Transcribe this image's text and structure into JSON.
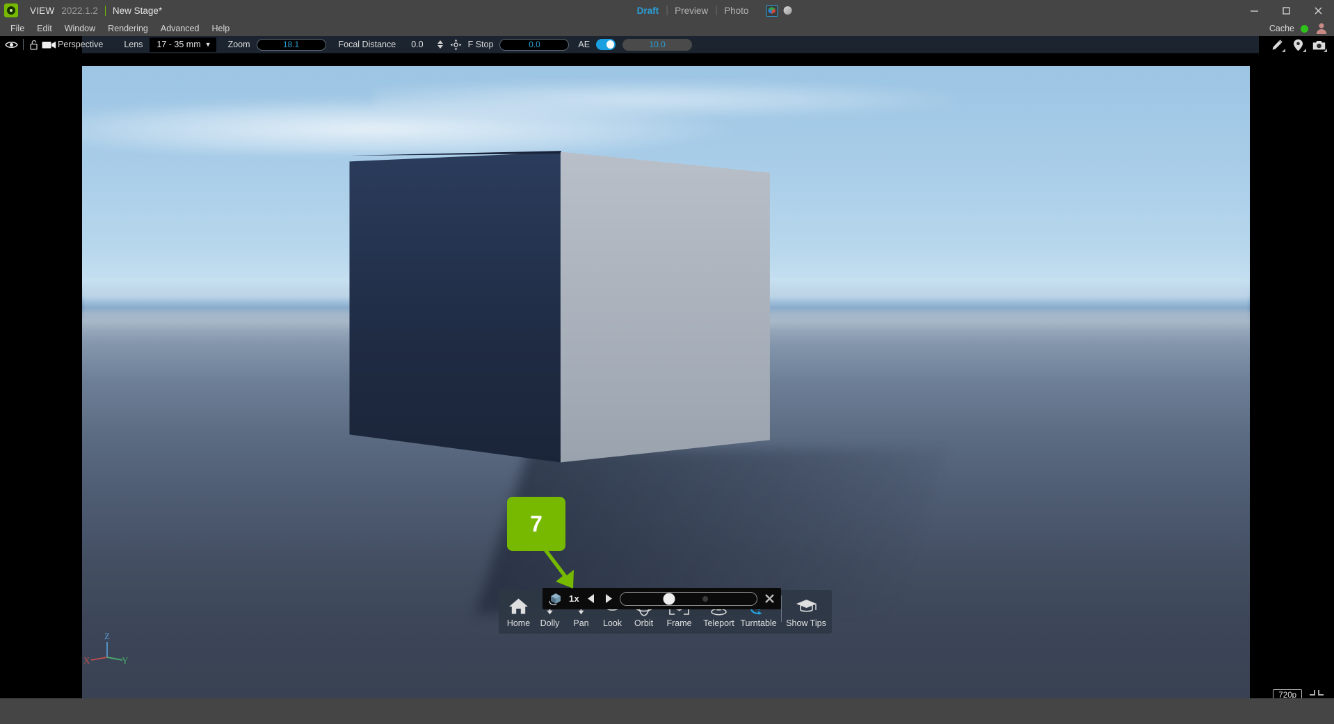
{
  "titlebar": {
    "app_name": "VIEW",
    "version": "2022.1.2",
    "stage_name": "New Stage*",
    "logo_icon": "omniverse-logo-icon",
    "minimize_icon": "minimize-icon",
    "maximize_icon": "maximize-icon",
    "close_icon": "close-icon"
  },
  "render_modes": {
    "tabs": [
      {
        "label": "Draft",
        "active": true
      },
      {
        "label": "Preview",
        "active": false
      },
      {
        "label": "Photo",
        "active": false
      }
    ],
    "rtx_icon": "rtx-cube-icon",
    "material_icon": "material-sphere-icon",
    "accent_color": "#2b9ed6"
  },
  "menubar": {
    "items": [
      "File",
      "Edit",
      "Window",
      "Rendering",
      "Advanced",
      "Help"
    ]
  },
  "cache": {
    "label": "Cache",
    "status_color": "#2ec11c",
    "status_icon": "status-dot-icon",
    "avatar_icon": "user-avatar-icon"
  },
  "camera_toolbar": {
    "visibility_icon": "eye-icon",
    "lock_icon": "lock-open-icon",
    "camera_icon": "camera-icon",
    "camera_name": "Perspective",
    "lens_label": "Lens",
    "lens_value": "17 - 35 mm",
    "lens_caret_icon": "chevron-down-icon",
    "zoom_label": "Zoom",
    "zoom_value": "18.1",
    "focal_distance_label": "Focal Distance",
    "focal_distance_value": "0.0",
    "spinner_icon": "stepper-arrows-icon",
    "focus_target_icon": "focus-crosshair-icon",
    "fstop_label": "F Stop",
    "fstop_value": "0.0",
    "ae_label": "AE",
    "ae_enabled": true,
    "ae_value": "10.0",
    "right_tools": [
      {
        "icon": "pencil-markup-icon"
      },
      {
        "icon": "location-pin-icon"
      },
      {
        "icon": "camera-capture-icon"
      }
    ]
  },
  "viewport": {
    "axis_gizmo": {
      "x_label": "X",
      "x_color": "#c0504d",
      "y_label": "Y",
      "y_color": "#4caf6e",
      "z_label": "Z",
      "z_color": "#5a9ed6"
    },
    "scene": {
      "cube_left_face_color": "#22304c",
      "cube_right_face_color": "#aeb5bf",
      "sky_top_color": "#9cc5e4",
      "ground_color": "#475468"
    }
  },
  "nav_toolbar": {
    "buttons": [
      {
        "label": "Home",
        "icon": "home-icon",
        "active": false
      },
      {
        "label": "Dolly",
        "icon": "dolly-icon",
        "active": false
      },
      {
        "label": "Pan",
        "icon": "pan-icon",
        "active": false
      },
      {
        "label": "Look",
        "icon": "look-icon",
        "active": false
      },
      {
        "label": "Orbit",
        "icon": "orbit-icon",
        "active": false
      },
      {
        "label": "Frame",
        "icon": "frame-icon",
        "active": false
      },
      {
        "label": "Teleport",
        "icon": "teleport-icon",
        "active": false
      },
      {
        "label": "Turntable",
        "icon": "turntable-icon",
        "active": true
      },
      {
        "label": "Show Tips",
        "icon": "graduation-cap-icon",
        "active": false
      }
    ],
    "active_color": "#2b9ed6"
  },
  "turntable_overlay": {
    "cube_icon": "turntable-cube-icon",
    "speed_label": "1x",
    "step_back_icon": "play-backward-icon",
    "step_forward_icon": "play-forward-icon",
    "slider_handle_position_pct": 35,
    "close_icon": "close-icon"
  },
  "callout": {
    "number": "7",
    "color": "#76b900",
    "arrow_icon": "callout-arrow-icon"
  },
  "hud": {
    "resolution": "720p",
    "monitor_icon": "monitor-icon",
    "fullscreen_icon": "collapse-fullscreen-icon"
  }
}
